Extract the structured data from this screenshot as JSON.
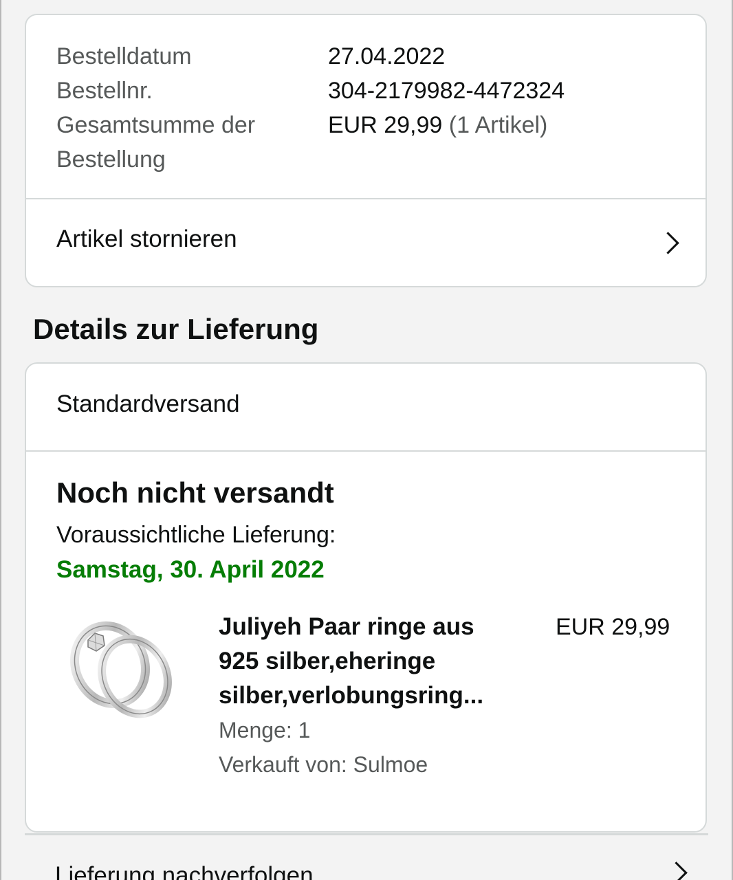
{
  "order": {
    "date_label": "Bestelldatum",
    "date_value": "27.04.2022",
    "number_label": "Bestellnr.",
    "number_value": "304-2179982-4472324",
    "total_label_line1": "Gesamtsumme der",
    "total_label_line2": "Bestellung",
    "total_value": "EUR 29,99",
    "total_items": "(1 Artikel)",
    "cancel_label": "Artikel stornieren"
  },
  "delivery_heading": "Details zur Lieferung",
  "delivery": {
    "shipping_method": "Standardversand",
    "status": "Noch nicht versandt",
    "eta_label": "Voraussichtliche Lieferung:",
    "eta_date": "Samstag, 30. April 2022",
    "status_color": "#067d06"
  },
  "product": {
    "title_line1": "Juliyeh Paar ringe aus",
    "title_line2": "925 silber,eheringe",
    "title_line3": "silber,verlobungsring...",
    "price": "EUR 29,99",
    "quantity": "Menge: 1",
    "seller": "Verkauft von: Sulmoe"
  },
  "track_label": "Lieferung nachverfolgen"
}
